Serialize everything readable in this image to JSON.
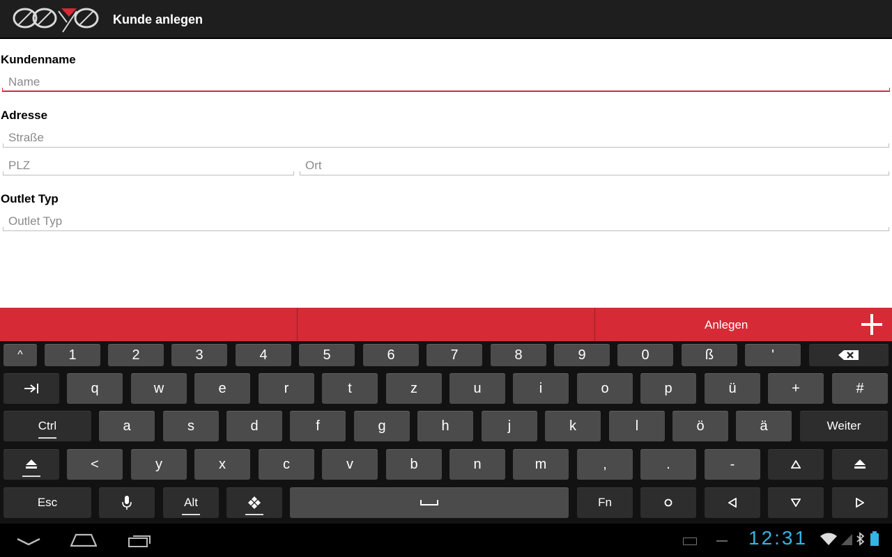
{
  "app": {
    "title": "Kunde anlegen"
  },
  "form": {
    "name_label": "Kundenname",
    "name_placeholder": "Name",
    "address_label": "Adresse",
    "street_placeholder": "Straße",
    "zip_placeholder": "PLZ",
    "city_placeholder": "Ort",
    "outlet_label": "Outlet Typ",
    "outlet_placeholder": "Outlet Typ"
  },
  "actions": {
    "create_label": "Anlegen"
  },
  "keyboard": {
    "row1": [
      "^",
      "1",
      "2",
      "3",
      "4",
      "5",
      "6",
      "7",
      "8",
      "9",
      "0",
      "ß",
      "'"
    ],
    "row2": [
      "q",
      "w",
      "e",
      "r",
      "t",
      "z",
      "u",
      "i",
      "o",
      "p",
      "ü",
      "+",
      "#"
    ],
    "row3": [
      "a",
      "s",
      "d",
      "f",
      "g",
      "h",
      "j",
      "k",
      "l",
      "ö",
      "ä"
    ],
    "row4": [
      "<",
      "y",
      "x",
      "c",
      "v",
      "b",
      "n",
      "m",
      ",",
      ".",
      "-"
    ],
    "ctrl": "Ctrl",
    "weiter": "Weiter",
    "esc": "Esc",
    "alt": "Alt",
    "fn": "Fn",
    "icons": [
      "backspace-icon",
      "tab-icon",
      "shift-icon",
      "mic-icon",
      "settings-diamond-icon",
      "space-icon",
      "cursor-home-icon",
      "arrow-up-icon",
      "arrow-left-icon",
      "arrow-down-icon",
      "arrow-right-icon"
    ]
  },
  "status": {
    "time": "12:31"
  },
  "colors": {
    "accent": "#d62a36",
    "clock": "#33b5e5",
    "actionbar": "#1e1e1e"
  }
}
